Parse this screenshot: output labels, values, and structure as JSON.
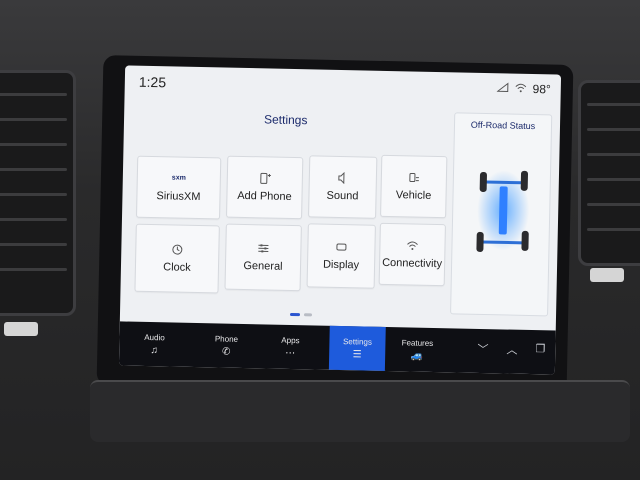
{
  "status_bar": {
    "time": "1:25",
    "temperature": "98°"
  },
  "settings": {
    "title": "Settings",
    "tiles": [
      {
        "label": "SiriusXM",
        "icon": "sxm"
      },
      {
        "label": "Add Phone",
        "icon": "phone-plus-icon"
      },
      {
        "label": "Sound",
        "icon": "speaker-icon"
      },
      {
        "label": "Vehicle",
        "icon": "vehicle-icon"
      },
      {
        "label": "Clock",
        "icon": "clock-icon"
      },
      {
        "label": "General",
        "icon": "sliders-icon"
      },
      {
        "label": "Display",
        "icon": "display-icon"
      },
      {
        "label": "Connectivity",
        "icon": "wifi-icon"
      }
    ]
  },
  "offroad": {
    "title": "Off-Road Status"
  },
  "nav": {
    "items": [
      {
        "label": "Audio",
        "icon": "music-note-icon"
      },
      {
        "label": "Phone",
        "icon": "phone-icon"
      },
      {
        "label": "Apps",
        "icon": "apps-grid-icon"
      },
      {
        "label": "Settings",
        "icon": "sliders-icon",
        "active": true
      },
      {
        "label": "Features",
        "icon": "car-icon"
      }
    ]
  },
  "colors": {
    "accent": "#1e5bdc",
    "title": "#1b2a6b",
    "screen_bg": "#eef0f3",
    "nav_bg": "#0e0f14"
  }
}
